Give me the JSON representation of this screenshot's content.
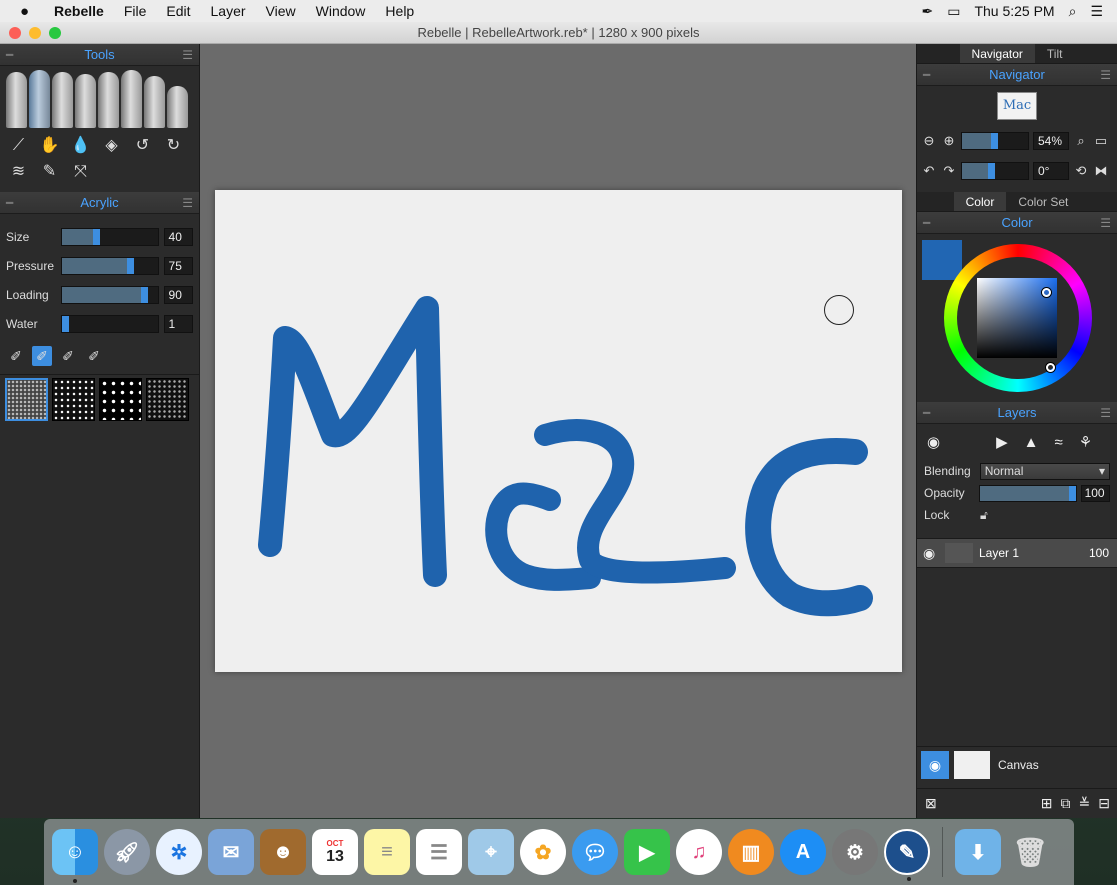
{
  "menubar": {
    "app_name": "Rebelle",
    "items": [
      "File",
      "Edit",
      "Layer",
      "View",
      "Window",
      "Help"
    ],
    "clock": "Thu 5:25 PM"
  },
  "window": {
    "title": "Rebelle | RebelleArtwork.reb* | 1280 x 900 pixels"
  },
  "tools_panel": {
    "title": "Tools",
    "brushes": [
      "brush-1",
      "brush-2",
      "brush-3",
      "brush-4",
      "brush-5",
      "brush-6",
      "brush-7",
      "brush-8"
    ],
    "selected_brush": 1
  },
  "acrylic_panel": {
    "title": "Acrylic",
    "sliders": [
      {
        "label": "Size",
        "value": "40",
        "fraction": 0.4
      },
      {
        "label": "Pressure",
        "value": "75",
        "fraction": 0.75
      },
      {
        "label": "Loading",
        "value": "90",
        "fraction": 0.9
      },
      {
        "label": "Water",
        "value": "1",
        "fraction": 0.01
      }
    ]
  },
  "canvas": {
    "artwork_text": "Mac",
    "stroke_color": "#1f63ad"
  },
  "navigator": {
    "tabs": [
      "Navigator",
      "Tilt"
    ],
    "title": "Navigator",
    "thumbnail_text": "Mac",
    "zoom_value": "54%",
    "zoom_fraction": 0.54,
    "rotation_value": "0°",
    "rotation_fraction": 0.5
  },
  "color": {
    "tabs": [
      "Color",
      "Color Set"
    ],
    "title": "Color",
    "current_color": "#2166b3"
  },
  "layers": {
    "title": "Layers",
    "blending_label": "Blending",
    "blending_value": "Normal",
    "opacity_label": "Opacity",
    "opacity_value": "100",
    "opacity_fraction": 1.0,
    "lock_label": "Lock",
    "items": [
      {
        "name": "Layer 1",
        "opacity": "100"
      }
    ],
    "canvas_label": "Canvas"
  },
  "dock": {
    "calendar_month": "OCT",
    "calendar_day": "13"
  }
}
